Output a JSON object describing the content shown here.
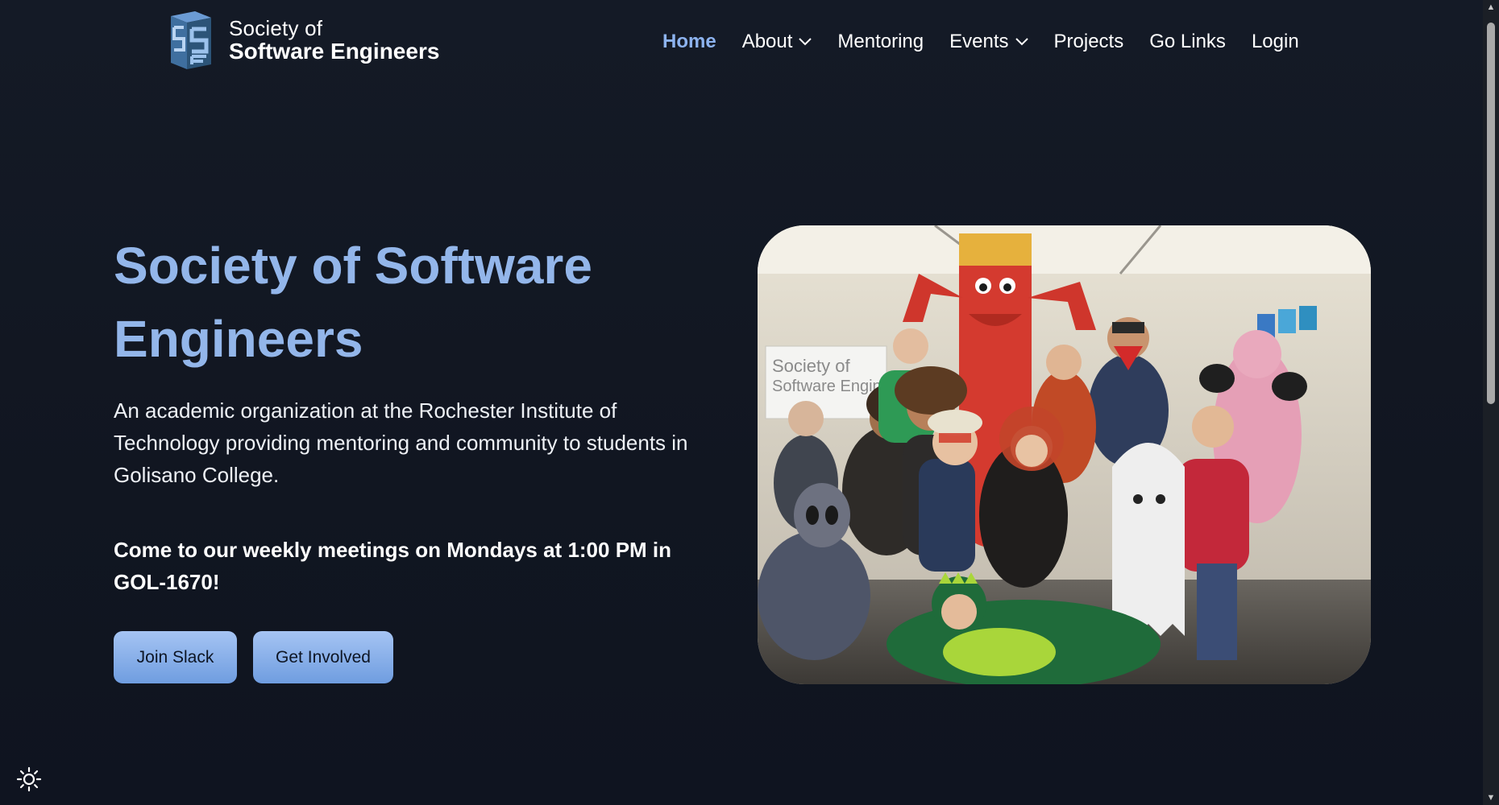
{
  "header": {
    "logo_line1": "Society of",
    "logo_line2": "Software Engineers",
    "nav": [
      {
        "label": "Home",
        "active": true,
        "dropdown": false
      },
      {
        "label": "About",
        "active": false,
        "dropdown": true
      },
      {
        "label": "Mentoring",
        "active": false,
        "dropdown": false
      },
      {
        "label": "Events",
        "active": false,
        "dropdown": true
      },
      {
        "label": "Projects",
        "active": false,
        "dropdown": false
      },
      {
        "label": "Go Links",
        "active": false,
        "dropdown": false
      },
      {
        "label": "Login",
        "active": false,
        "dropdown": false
      }
    ]
  },
  "hero": {
    "title": "Society of Software Engineers",
    "description": "An academic organization at the Rochester Institute of Technology providing mentoring and community to students in Golisano College.",
    "meeting": "Come to our weekly meetings on Mondays at 1:00 PM in GOL-1670!",
    "buttons": {
      "slack": "Join Slack",
      "involved": "Get Involved"
    },
    "photo_sign": "Society of Software Engineers"
  },
  "colors": {
    "background": "#121722",
    "accent": "#93b6ea",
    "nav_active": "#8db3ef",
    "button": "#8fb3ec"
  },
  "icons": {
    "theme_toggle": "sun-icon",
    "dropdown": "chevron-down-icon"
  }
}
